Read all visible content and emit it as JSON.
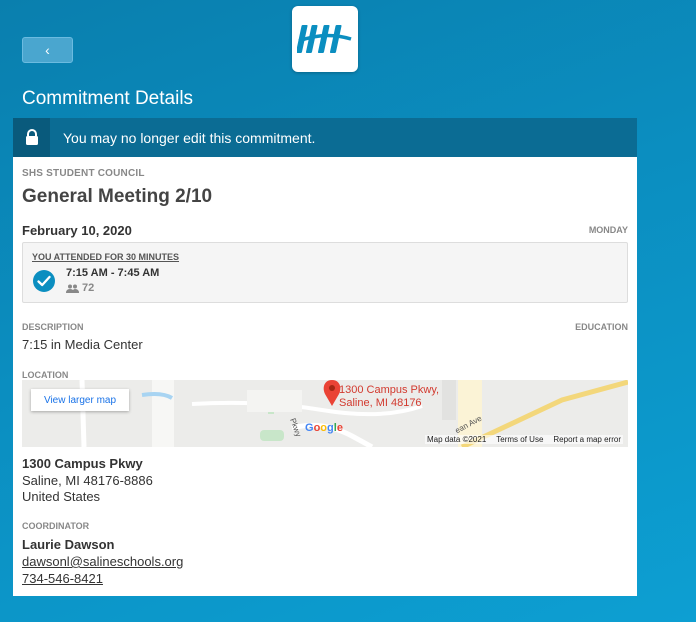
{
  "header": {
    "back_icon": "chevron-left-icon",
    "back_glyph": "‹",
    "title": "Commitment Details",
    "logo_icon": "app-logo"
  },
  "banner": {
    "icon": "lock-icon",
    "message": "You may no longer edit this commitment."
  },
  "commitment": {
    "organization": "SHS STUDENT COUNCIL",
    "title": "General Meeting 2/10",
    "date": "February 10, 2020",
    "weekday": "MONDAY",
    "attendance": {
      "heading": "YOU ATTENDED FOR 30 MINUTES",
      "time": "7:15 AM - 7:45 AM",
      "count": "72",
      "count_icon": "people-icon",
      "status_icon": "check-circle-icon"
    },
    "description_label": "DESCRIPTION",
    "description": "7:15 in Media Center",
    "category": "EDUCATION",
    "location_label": "LOCATION",
    "map": {
      "larger_map": "View larger map",
      "marker_line1": "1300 Campus Pkwy,",
      "marker_line2": "Saline, MI 48176",
      "brand": "Google",
      "map_data": "Map data ©2021",
      "terms": "Terms of Use",
      "report": "Report a map error",
      "street_label": "Pkwy",
      "street_label2": "ean Ave"
    },
    "address": {
      "line1": "1300 Campus Pkwy",
      "line2": "Saline, MI 48176-8886",
      "line3": "United States"
    },
    "coordinator_label": "COORDINATOR",
    "coordinator": {
      "name": "Laurie Dawson",
      "email": "dawsonl@salineschools.org",
      "phone": "734-546-8421"
    }
  },
  "colors": {
    "accent": "#0b8ec0",
    "banner": "#0b6c94",
    "marker": "#d23a2f"
  }
}
